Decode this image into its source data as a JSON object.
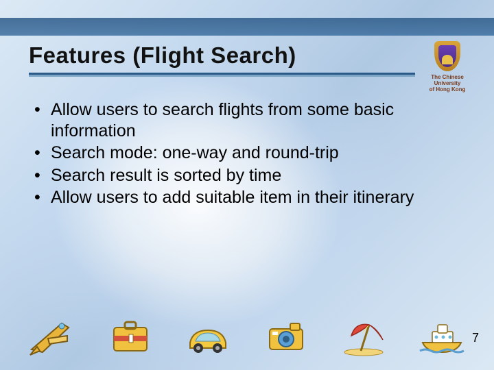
{
  "title": "Features (Flight Search)",
  "logo": {
    "line1": "The Chinese University",
    "line2": "of Hong Kong"
  },
  "bullets": [
    "Allow users to search flights from some basic information",
    "Search mode: one-way and round-trip",
    "Search result is sorted by time",
    "Allow users to add suitable item in their itinerary"
  ],
  "page_number": "7",
  "icons": [
    "airplane",
    "suitcase",
    "car",
    "camera",
    "beach-umbrella",
    "ship"
  ]
}
